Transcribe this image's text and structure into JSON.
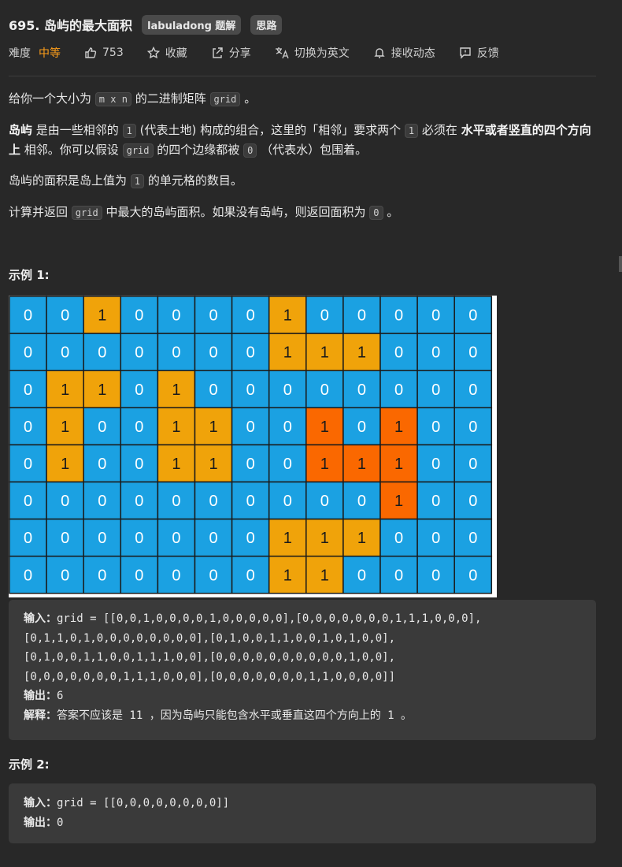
{
  "header": {
    "title": "695. 岛屿的最大面积",
    "tags": [
      "labuladong 题解",
      "思路"
    ]
  },
  "meta": {
    "difficulty_label": "难度",
    "difficulty_value": "中等",
    "likes": "753",
    "favorite": "收藏",
    "share": "分享",
    "switch_lang": "切换为英文",
    "subscribe": "接收动态",
    "feedback": "反馈"
  },
  "description": {
    "p1": {
      "a": "给你一个大小为",
      "code1": "m x n",
      "b": "的二进制矩阵",
      "code2": "grid",
      "c": "。"
    },
    "p2": {
      "strong1": "岛屿",
      "a": "是由一些相邻的",
      "code1": "1",
      "b": "(代表土地) 构成的组合，这里的「相邻」要求两个",
      "code2": "1",
      "c": "必须在",
      "strong2": "水平或者竖直的四个方向上",
      "d": "相邻。你可以假设",
      "code3": "grid",
      "e": "的四个边缘都被",
      "code4": "0",
      "f": "（代表水）包围着。"
    },
    "p3": {
      "a": "岛屿的面积是岛上值为",
      "code1": "1",
      "b": "的单元格的数目。"
    },
    "p4": {
      "a": "计算并返回",
      "code1": "grid",
      "b": "中最大的岛屿面积。如果没有岛屿，则返回面积为",
      "code2": "0",
      "c": "。"
    }
  },
  "example1": {
    "title": "示例 1:",
    "grid": [
      [
        0,
        0,
        1,
        0,
        0,
        0,
        0,
        1,
        0,
        0,
        0,
        0,
        0
      ],
      [
        0,
        0,
        0,
        0,
        0,
        0,
        0,
        1,
        1,
        1,
        0,
        0,
        0
      ],
      [
        0,
        1,
        1,
        0,
        1,
        0,
        0,
        0,
        0,
        0,
        0,
        0,
        0
      ],
      [
        0,
        1,
        0,
        0,
        1,
        1,
        0,
        0,
        1,
        0,
        1,
        0,
        0
      ],
      [
        0,
        1,
        0,
        0,
        1,
        1,
        0,
        0,
        1,
        1,
        1,
        0,
        0
      ],
      [
        0,
        0,
        0,
        0,
        0,
        0,
        0,
        0,
        0,
        0,
        1,
        0,
        0
      ],
      [
        0,
        0,
        0,
        0,
        0,
        0,
        0,
        1,
        1,
        1,
        0,
        0,
        0
      ],
      [
        0,
        0,
        0,
        0,
        0,
        0,
        0,
        1,
        1,
        0,
        0,
        0,
        0
      ]
    ],
    "highlight": [
      [
        3,
        8
      ],
      [
        3,
        10
      ],
      [
        4,
        8
      ],
      [
        4,
        9
      ],
      [
        4,
        10
      ],
      [
        5,
        10
      ]
    ],
    "colors": {
      "water": "#1ba1e2",
      "land": "#f0a30a",
      "largest": "#fa6800"
    },
    "input_label": "输入：",
    "input_lines": [
      "grid = [[0,0,1,0,0,0,0,1,0,0,0,0,0],[0,0,0,0,0,0,0,1,1,1,0,0,0],",
      "[0,1,1,0,1,0,0,0,0,0,0,0,0],[0,1,0,0,1,1,0,0,1,0,1,0,0],",
      "[0,1,0,0,1,1,0,0,1,1,1,0,0],[0,0,0,0,0,0,0,0,0,0,1,0,0],",
      "[0,0,0,0,0,0,0,1,1,1,0,0,0],[0,0,0,0,0,0,0,1,1,0,0,0,0]]"
    ],
    "output_label": "输出：",
    "output_value": "6",
    "explain_label": "解释：",
    "explain_text": "答案不应该是 11 ，因为岛屿只能包含水平或垂直这四个方向上的 1 。"
  },
  "example2": {
    "title": "示例 2:",
    "input_label": "输入：",
    "input_value": "grid = [[0,0,0,0,0,0,0,0]]",
    "output_label": "输出：",
    "output_value": "0"
  }
}
